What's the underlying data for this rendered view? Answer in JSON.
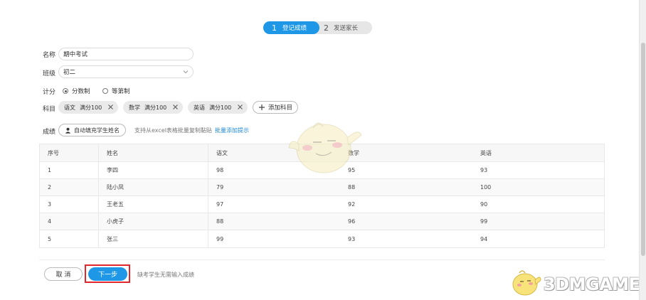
{
  "steps": [
    {
      "num": "1",
      "label": "登记成绩"
    },
    {
      "num": "2",
      "label": "发送家长"
    }
  ],
  "form": {
    "name_label": "名称",
    "name_value": "期中考试",
    "class_label": "班级",
    "class_value": "初二",
    "score_type_label": "计分",
    "score_types": [
      {
        "label": "分数制",
        "selected": true
      },
      {
        "label": "等第制",
        "selected": false
      }
    ],
    "subject_label": "科目",
    "subjects": [
      {
        "name": "语文",
        "full": "满分100"
      },
      {
        "name": "数学",
        "full": "满分100"
      },
      {
        "name": "英语",
        "full": "满分100"
      }
    ],
    "add_subject_label": "添加科目",
    "grades_label": "成绩",
    "autofill_label": "自动填充学生姓名",
    "paste_hint": "支持从excel表格批量复制黏贴",
    "batch_hint_link": "批量添加提示"
  },
  "table": {
    "headers": [
      "序号",
      "姓名",
      "语文",
      "数学",
      "英语"
    ],
    "rows": [
      [
        "1",
        "李四",
        "98",
        "95",
        "93"
      ],
      [
        "2",
        "陆小凤",
        "79",
        "88",
        "100"
      ],
      [
        "3",
        "王老五",
        "97",
        "92",
        "90"
      ],
      [
        "4",
        "小虎子",
        "88",
        "96",
        "99"
      ],
      [
        "5",
        "张三",
        "99",
        "93",
        "94"
      ]
    ]
  },
  "footer": {
    "cancel_label": "取 消",
    "next_label": "下一步",
    "note": "缺考学生无需输入成绩"
  },
  "watermark": {
    "text": "3DMGAME"
  },
  "colors": {
    "accent": "#1e97e6",
    "highlight": "#e3262c",
    "link": "#1e88d6"
  }
}
